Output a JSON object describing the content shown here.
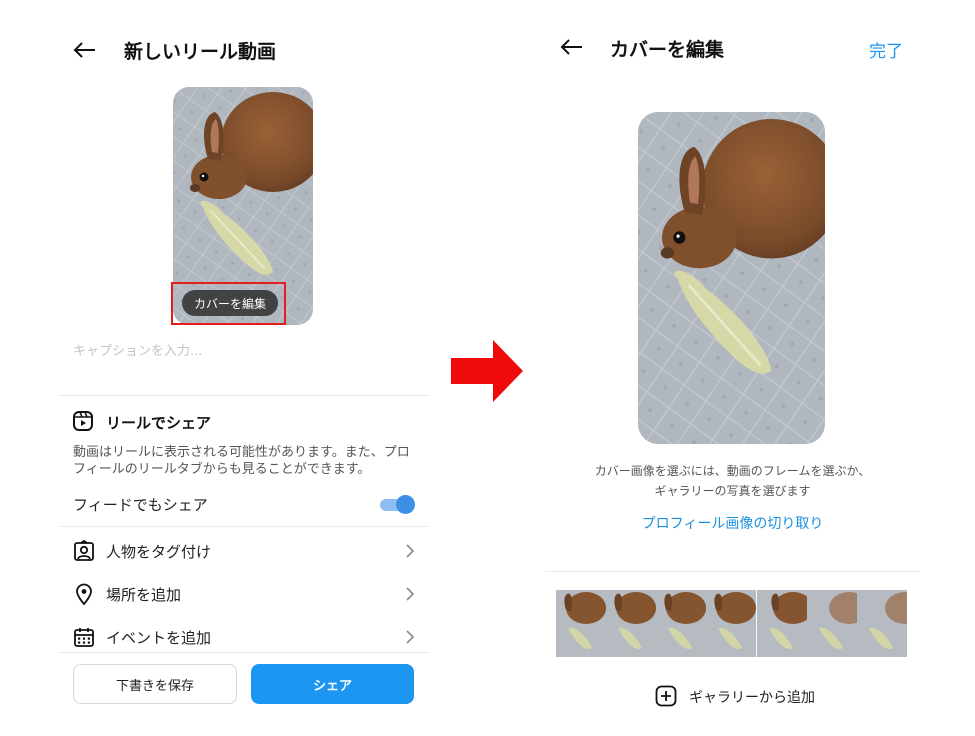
{
  "left": {
    "back_icon": "arrow-left-icon",
    "title": "新しいリール動画",
    "cover_edit_button": "カバーを編集",
    "caption_placeholder": "キャプションを入力...",
    "reels_share": {
      "icon": "reels-icon",
      "title": "リールでシェア",
      "description": "動画はリールに表示される可能性があります。また、プロフィールのリールタブからも見ることができます。"
    },
    "feed_share": {
      "label": "フィードでもシェア",
      "enabled": true
    },
    "rows": [
      {
        "icon": "person-tag-icon",
        "label": "人物をタグ付け"
      },
      {
        "icon": "location-pin-icon",
        "label": "場所を追加"
      },
      {
        "icon": "calendar-icon",
        "label": "イベントを追加"
      }
    ],
    "draft_button": "下書きを保存",
    "share_button": "シェア"
  },
  "right": {
    "back_icon": "arrow-left-icon",
    "title": "カバーを編集",
    "done_button": "完了",
    "hint_line1": "カバー画像を選ぶには、動画のフレームを選ぶか、",
    "hint_line2": "ギャラリーの写真を選びます",
    "profile_crop_link": "プロフィール画像の切り取り",
    "frame_count": 7,
    "gallery_add": {
      "icon": "plus-square-icon",
      "label": "ギャラリーから追加"
    }
  },
  "colors": {
    "accent_blue": "#1c96f0",
    "highlight_red": "#e41e1e",
    "arrow_red": "#ef0b0b"
  }
}
